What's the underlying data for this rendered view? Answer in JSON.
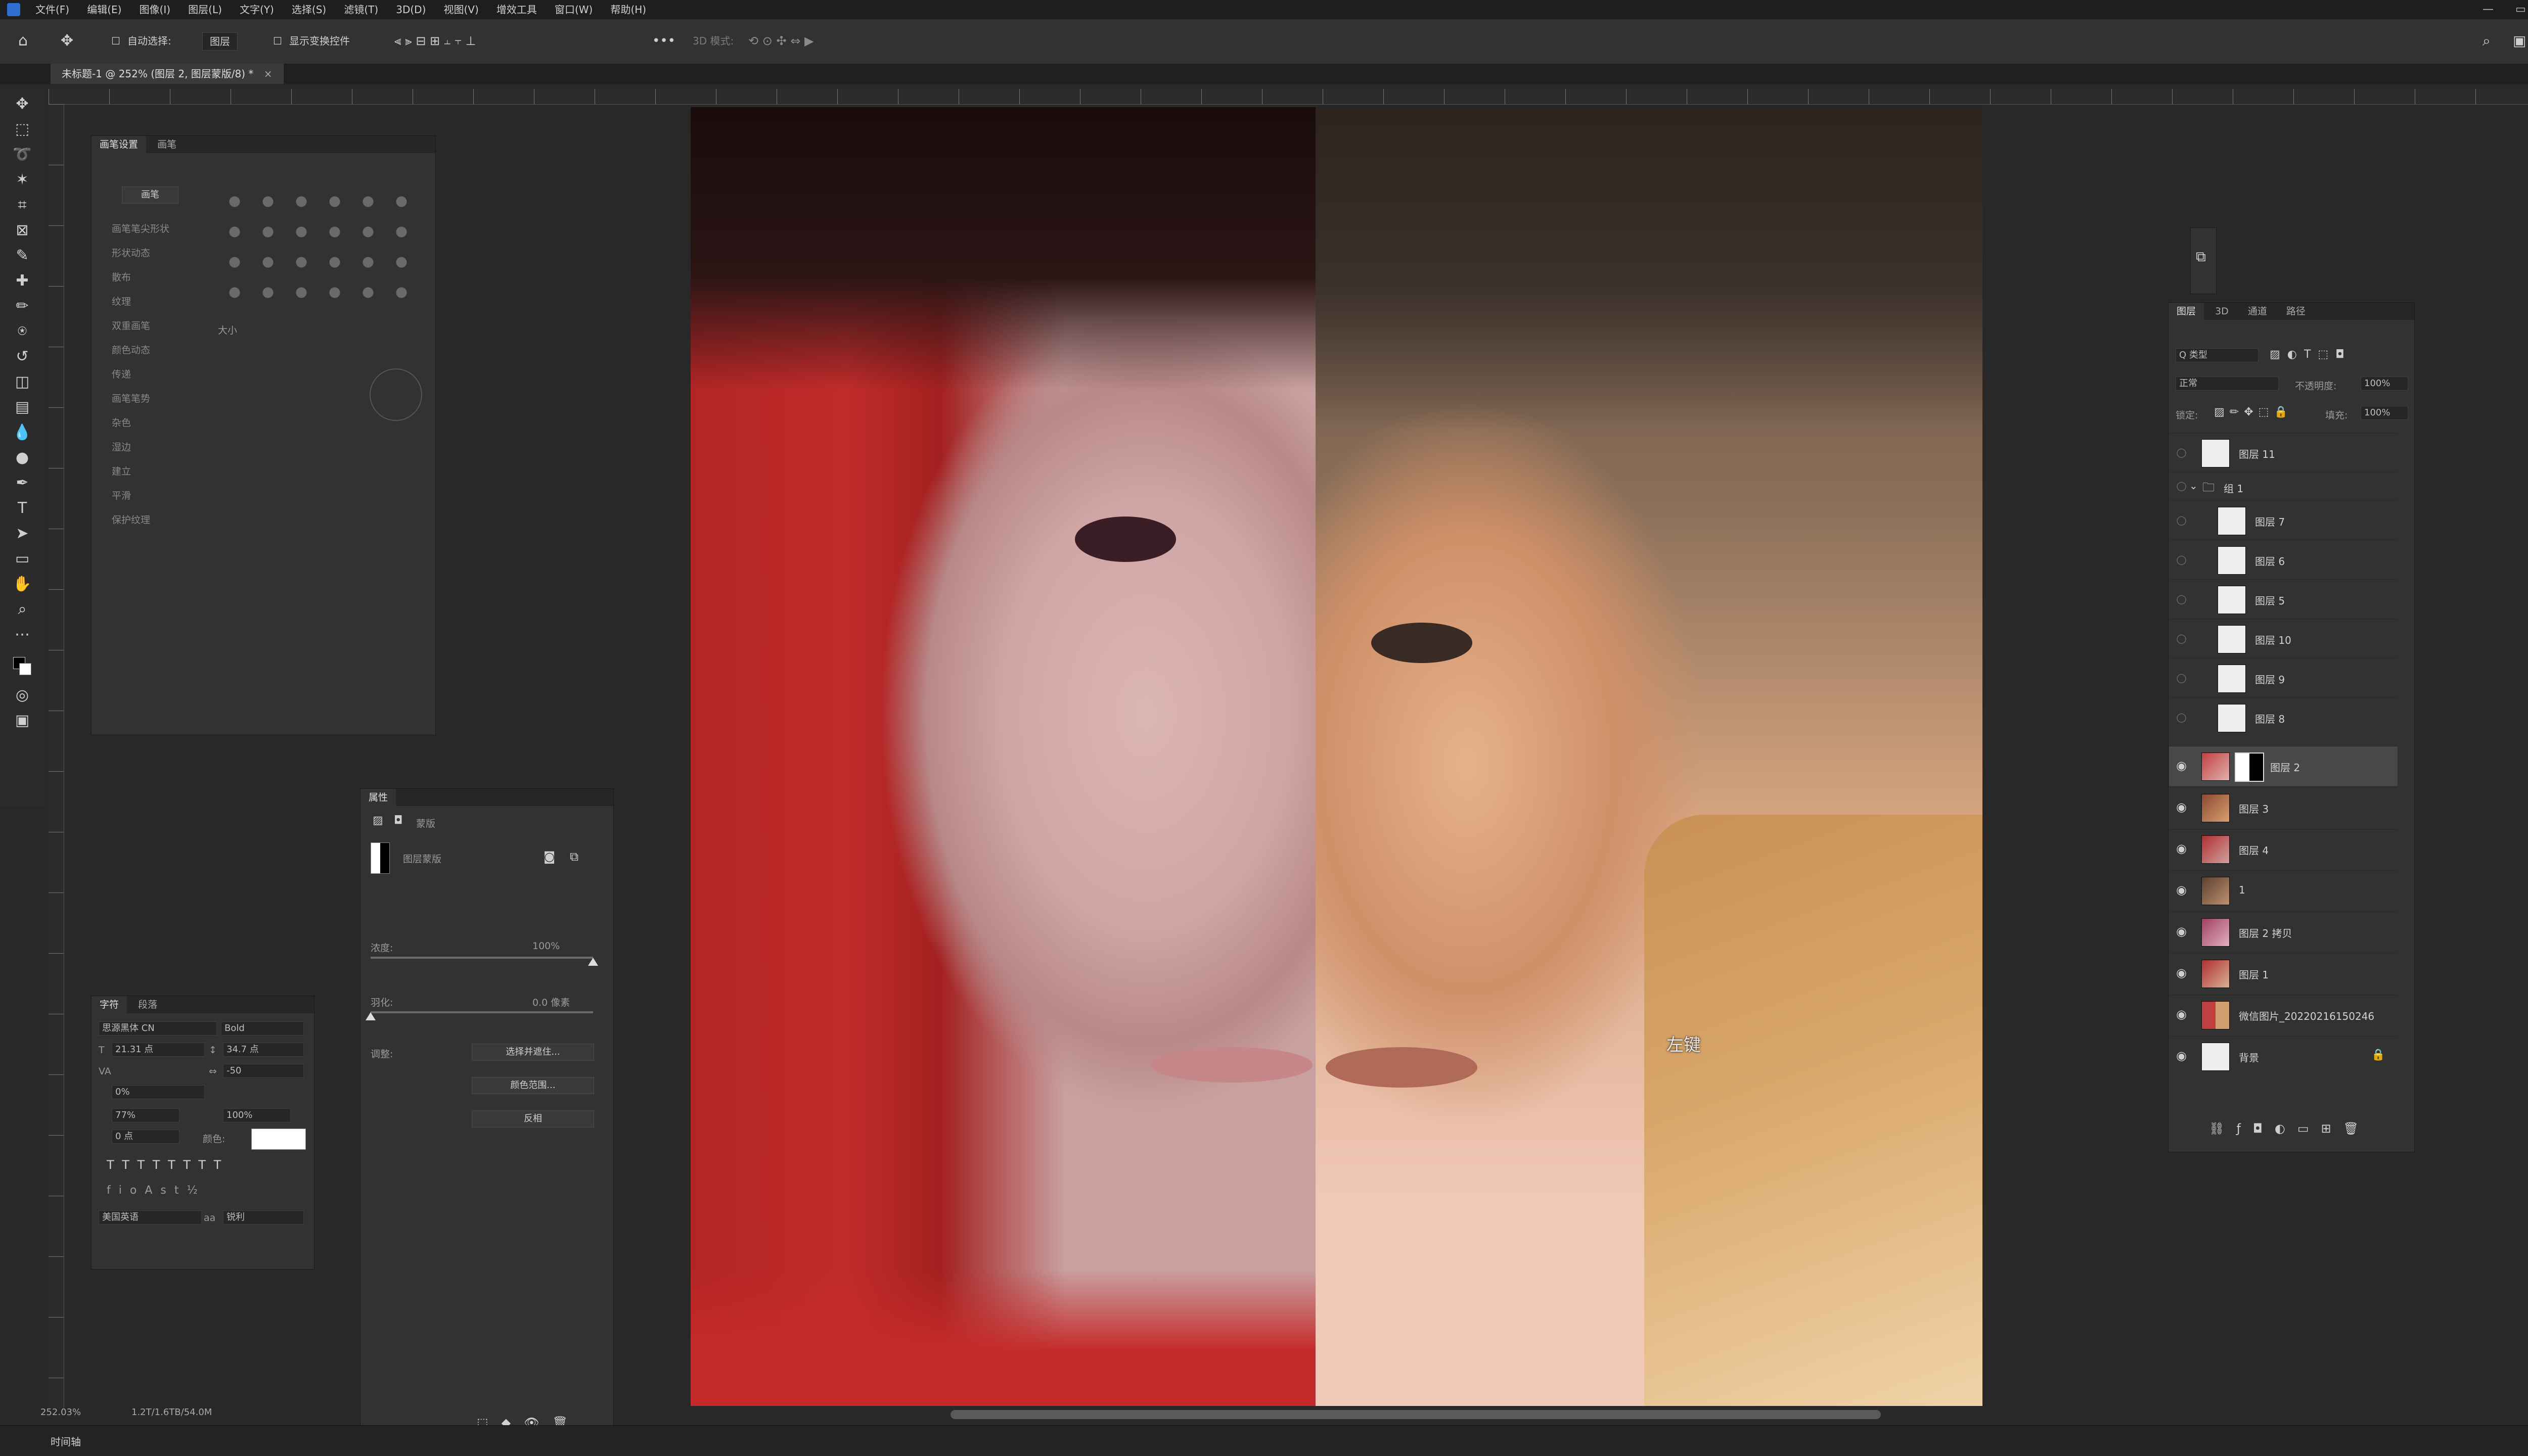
{
  "menubar": {
    "items": [
      "文件(F)",
      "编辑(E)",
      "图像(I)",
      "图层(L)",
      "文字(Y)",
      "选择(S)",
      "滤镜(T)",
      "3D(D)",
      "视图(V)",
      "增效工具",
      "窗口(W)",
      "帮助(H)"
    ],
    "window_controls": [
      "—",
      "▭",
      "✕"
    ]
  },
  "options": {
    "auto_select_label": "自动选择:",
    "auto_select_value": "图层",
    "transform_label": "显示变换控件",
    "mode_3d": "3D 模式:"
  },
  "document": {
    "tab_title": "未标题-1 @ 252% (图层 2, 图层蒙版/8) *"
  },
  "canvas": {
    "tooltip": "左键"
  },
  "brush_panel": {
    "tabs": [
      "画笔设置",
      "画笔"
    ],
    "brushes_button": "画笔",
    "options": [
      "画笔笔尖形状",
      "形状动态",
      "散布",
      "纹理",
      "双重画笔",
      "颜色动态",
      "传递",
      "画笔笔势",
      "杂色",
      "湿边",
      "建立",
      "平滑",
      "保护纹理"
    ],
    "size_label": "大小"
  },
  "character_panel": {
    "tabs": [
      "字符",
      "段落"
    ],
    "font_family": "思源黑体 CN",
    "font_style": "Bold",
    "size": "21.31 点",
    "leading": "34.7 点",
    "tracking_label": "VA",
    "tracking": "-50",
    "scale_percent": "0%",
    "vert_scale": "77%",
    "horiz_scale": "100%",
    "baseline": "0 点",
    "color_label": "颜色:",
    "language": "美国英语",
    "aa": "锐利",
    "aa_label": "aa"
  },
  "properties_panel": {
    "title": "属性",
    "mask_label": "蒙版",
    "layer_mask_label": "图层蒙版",
    "density_label": "浓度:",
    "density_value": "100%",
    "feather_label": "羽化:",
    "feather_value": "0.0 像素",
    "refine_label": "调整:",
    "select_mask_button": "选择并遮住...",
    "color_range_button": "颜色范围...",
    "invert_button": "反相"
  },
  "layers_panel": {
    "tabs": [
      "图层",
      "3D",
      "通道",
      "路径"
    ],
    "filter_label": "Q 类型",
    "blend_mode": "正常",
    "opacity_label": "不透明度:",
    "opacity_value": "100%",
    "lock_label": "锁定:",
    "fill_label": "填充:",
    "fill_value": "100%",
    "layers": [
      {
        "name": "图层 11",
        "visible": false,
        "kind": "white"
      },
      {
        "name": "组 1",
        "visible": false,
        "kind": "group"
      },
      {
        "name": "图层 7",
        "visible": false,
        "kind": "white"
      },
      {
        "name": "图层 6",
        "visible": false,
        "kind": "white"
      },
      {
        "name": "图层 5",
        "visible": false,
        "kind": "white"
      },
      {
        "name": "图层 10",
        "visible": false,
        "kind": "white"
      },
      {
        "name": "图层 9",
        "visible": false,
        "kind": "white"
      },
      {
        "name": "图层 8",
        "visible": false,
        "kind": "white"
      },
      {
        "name": "图层 2",
        "visible": true,
        "kind": "photo-mask",
        "selected": true
      },
      {
        "name": "图层 3",
        "visible": true,
        "kind": "photo"
      },
      {
        "name": "图层 4",
        "visible": true,
        "kind": "photo"
      },
      {
        "name": "1",
        "visible": true,
        "kind": "photo"
      },
      {
        "name": "图层 2 拷贝",
        "visible": true,
        "kind": "photo"
      },
      {
        "name": "图层 1",
        "visible": true,
        "kind": "photo"
      },
      {
        "name": "微信图片_20220216150246",
        "visible": true,
        "kind": "photo"
      },
      {
        "name": "背景",
        "visible": true,
        "kind": "white",
        "locked": true
      }
    ]
  },
  "status": {
    "zoom": "252.03%",
    "doc_info": "1.2T/1.6TB/54.0M",
    "bottom_label": "时间轴"
  },
  "colors": {
    "ui_dark": "#282828",
    "panel": "#323232",
    "selected_layer": "#484848"
  }
}
